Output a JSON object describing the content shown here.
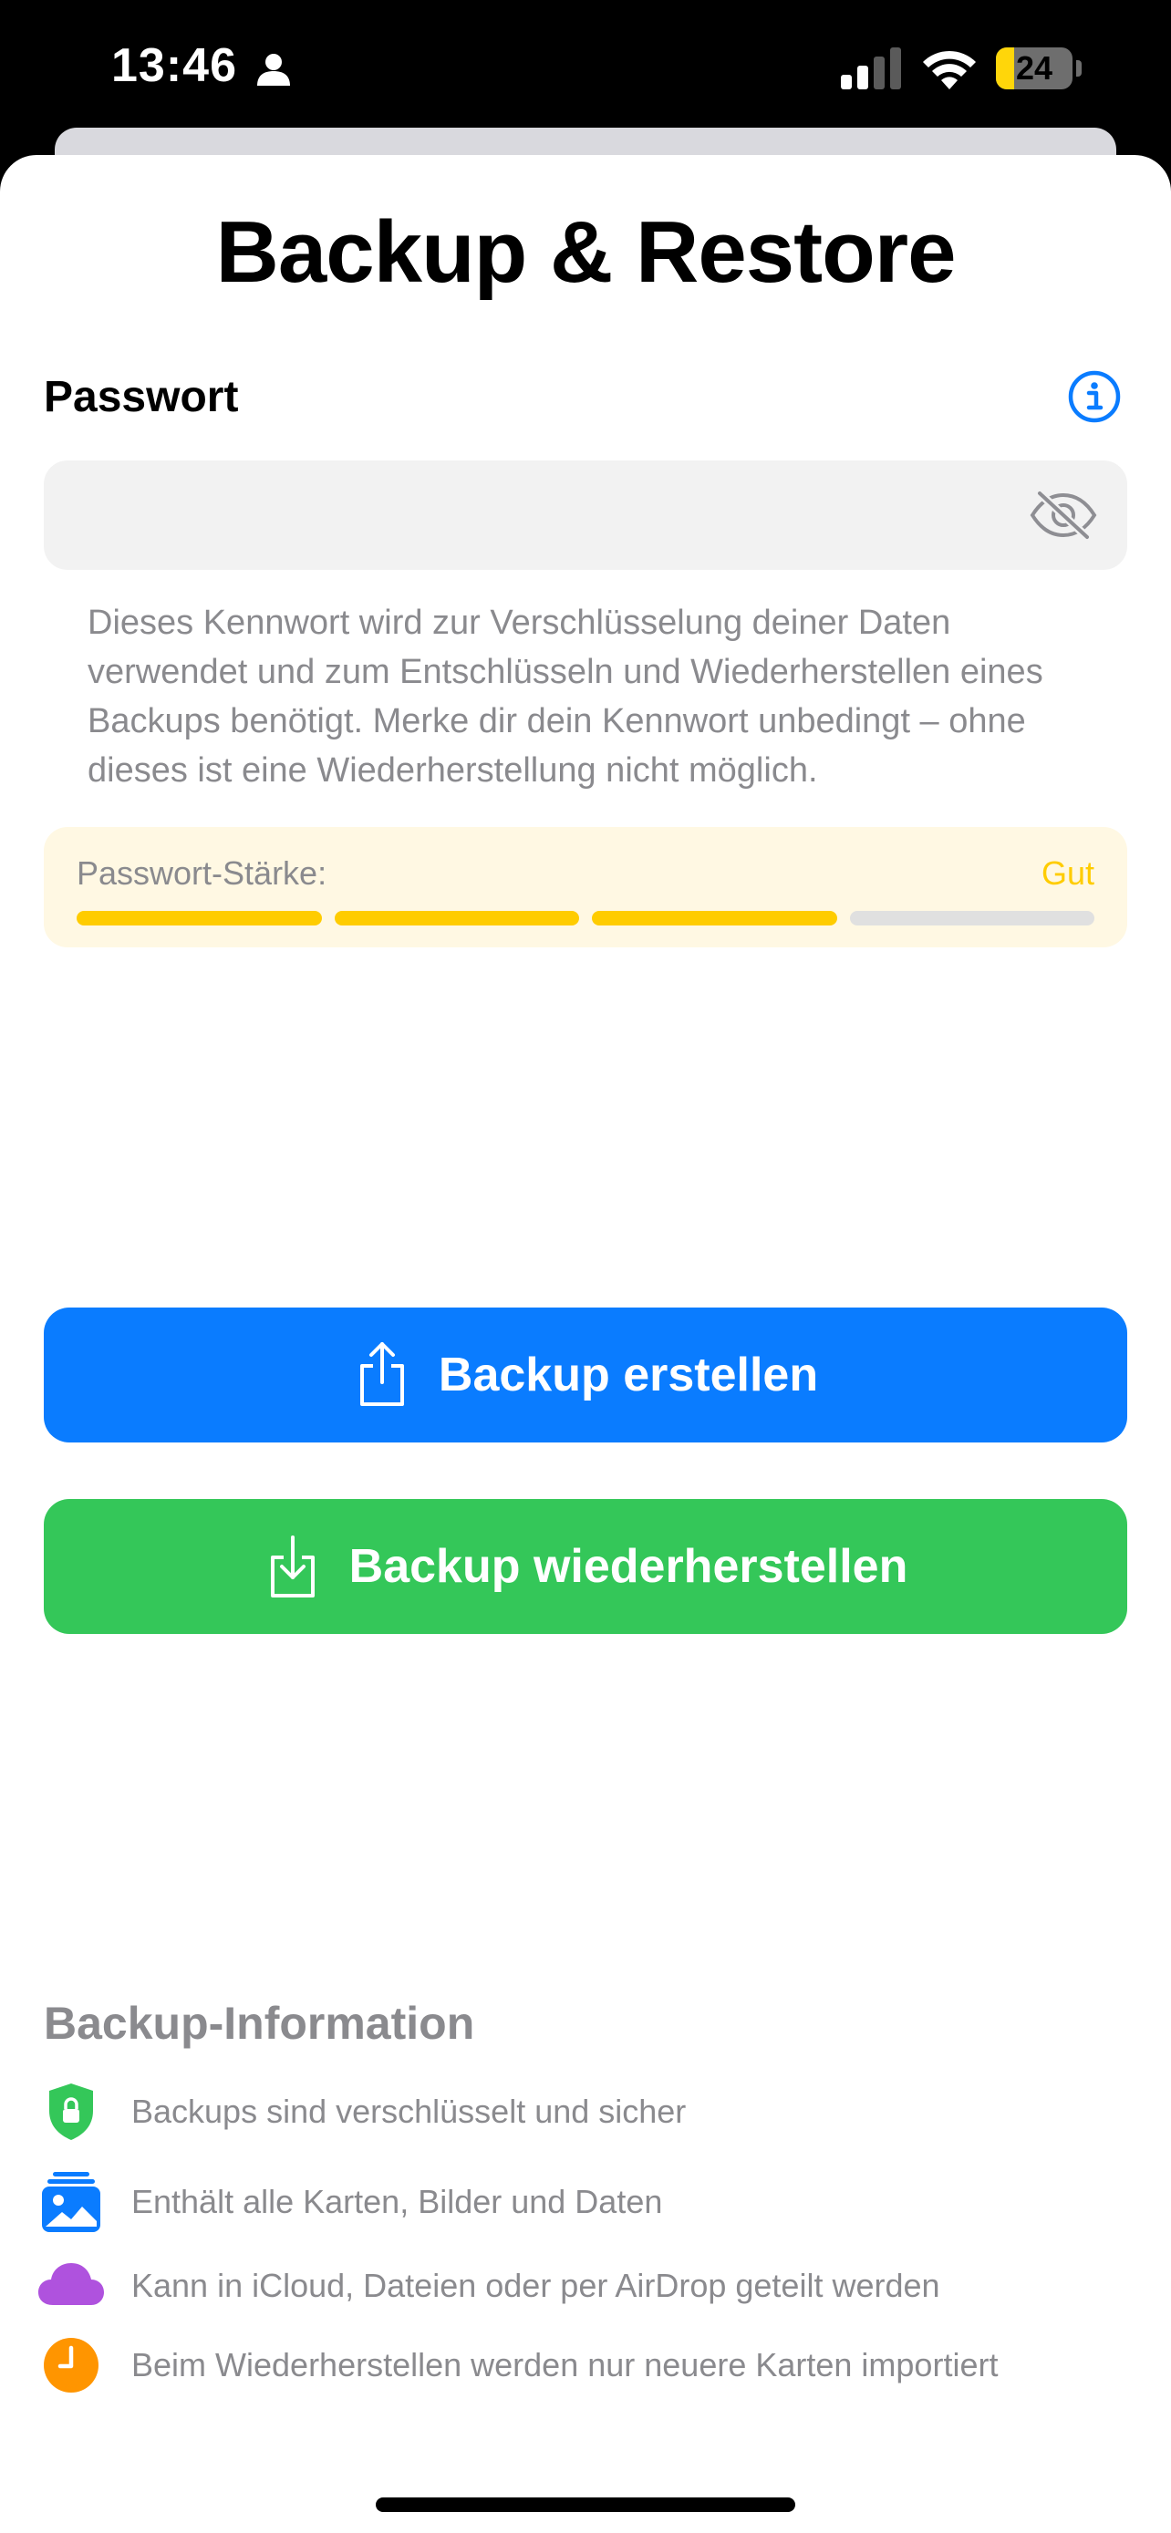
{
  "status_bar": {
    "time": "13:46",
    "battery": "24",
    "battery_level": 0.24
  },
  "title": "Backup & Restore",
  "password": {
    "label": "Passwort",
    "value": "",
    "placeholder": "",
    "description": "Dieses Kennwort wird zur Verschlüsselung deiner Daten verwendet und zum Entschlüsseln und Wiederherstellen eines Backups benötigt. Merke dir dein Kennwort unbedingt – ohne dieses ist eine Wiederherstellung nicht möglich."
  },
  "strength": {
    "label": "Passwort-Stärke:",
    "value": "Gut",
    "level": 3,
    "max": 4,
    "color": "#ffcc00"
  },
  "buttons": {
    "create": "Backup erstellen",
    "restore": "Backup wiederherstellen"
  },
  "info": {
    "heading": "Backup-Information",
    "items": [
      {
        "icon": "shield-lock-icon",
        "color": "#34c759",
        "text": "Backups sind verschlüsselt und sicher"
      },
      {
        "icon": "photo-stack-icon",
        "color": "#0a7cff",
        "text": "Enthält alle Karten, Bilder und Daten"
      },
      {
        "icon": "cloud-icon",
        "color": "#af52de",
        "text": "Kann in iCloud, Dateien oder per AirDrop geteilt werden"
      },
      {
        "icon": "clock-icon",
        "color": "#ff9500",
        "text": "Beim Wiederherstellen werden nur neuere Karten importiert"
      }
    ]
  },
  "colors": {
    "accent_blue": "#0a7cff",
    "accent_green": "#34c759",
    "secondary_text": "#8a8a8e"
  }
}
